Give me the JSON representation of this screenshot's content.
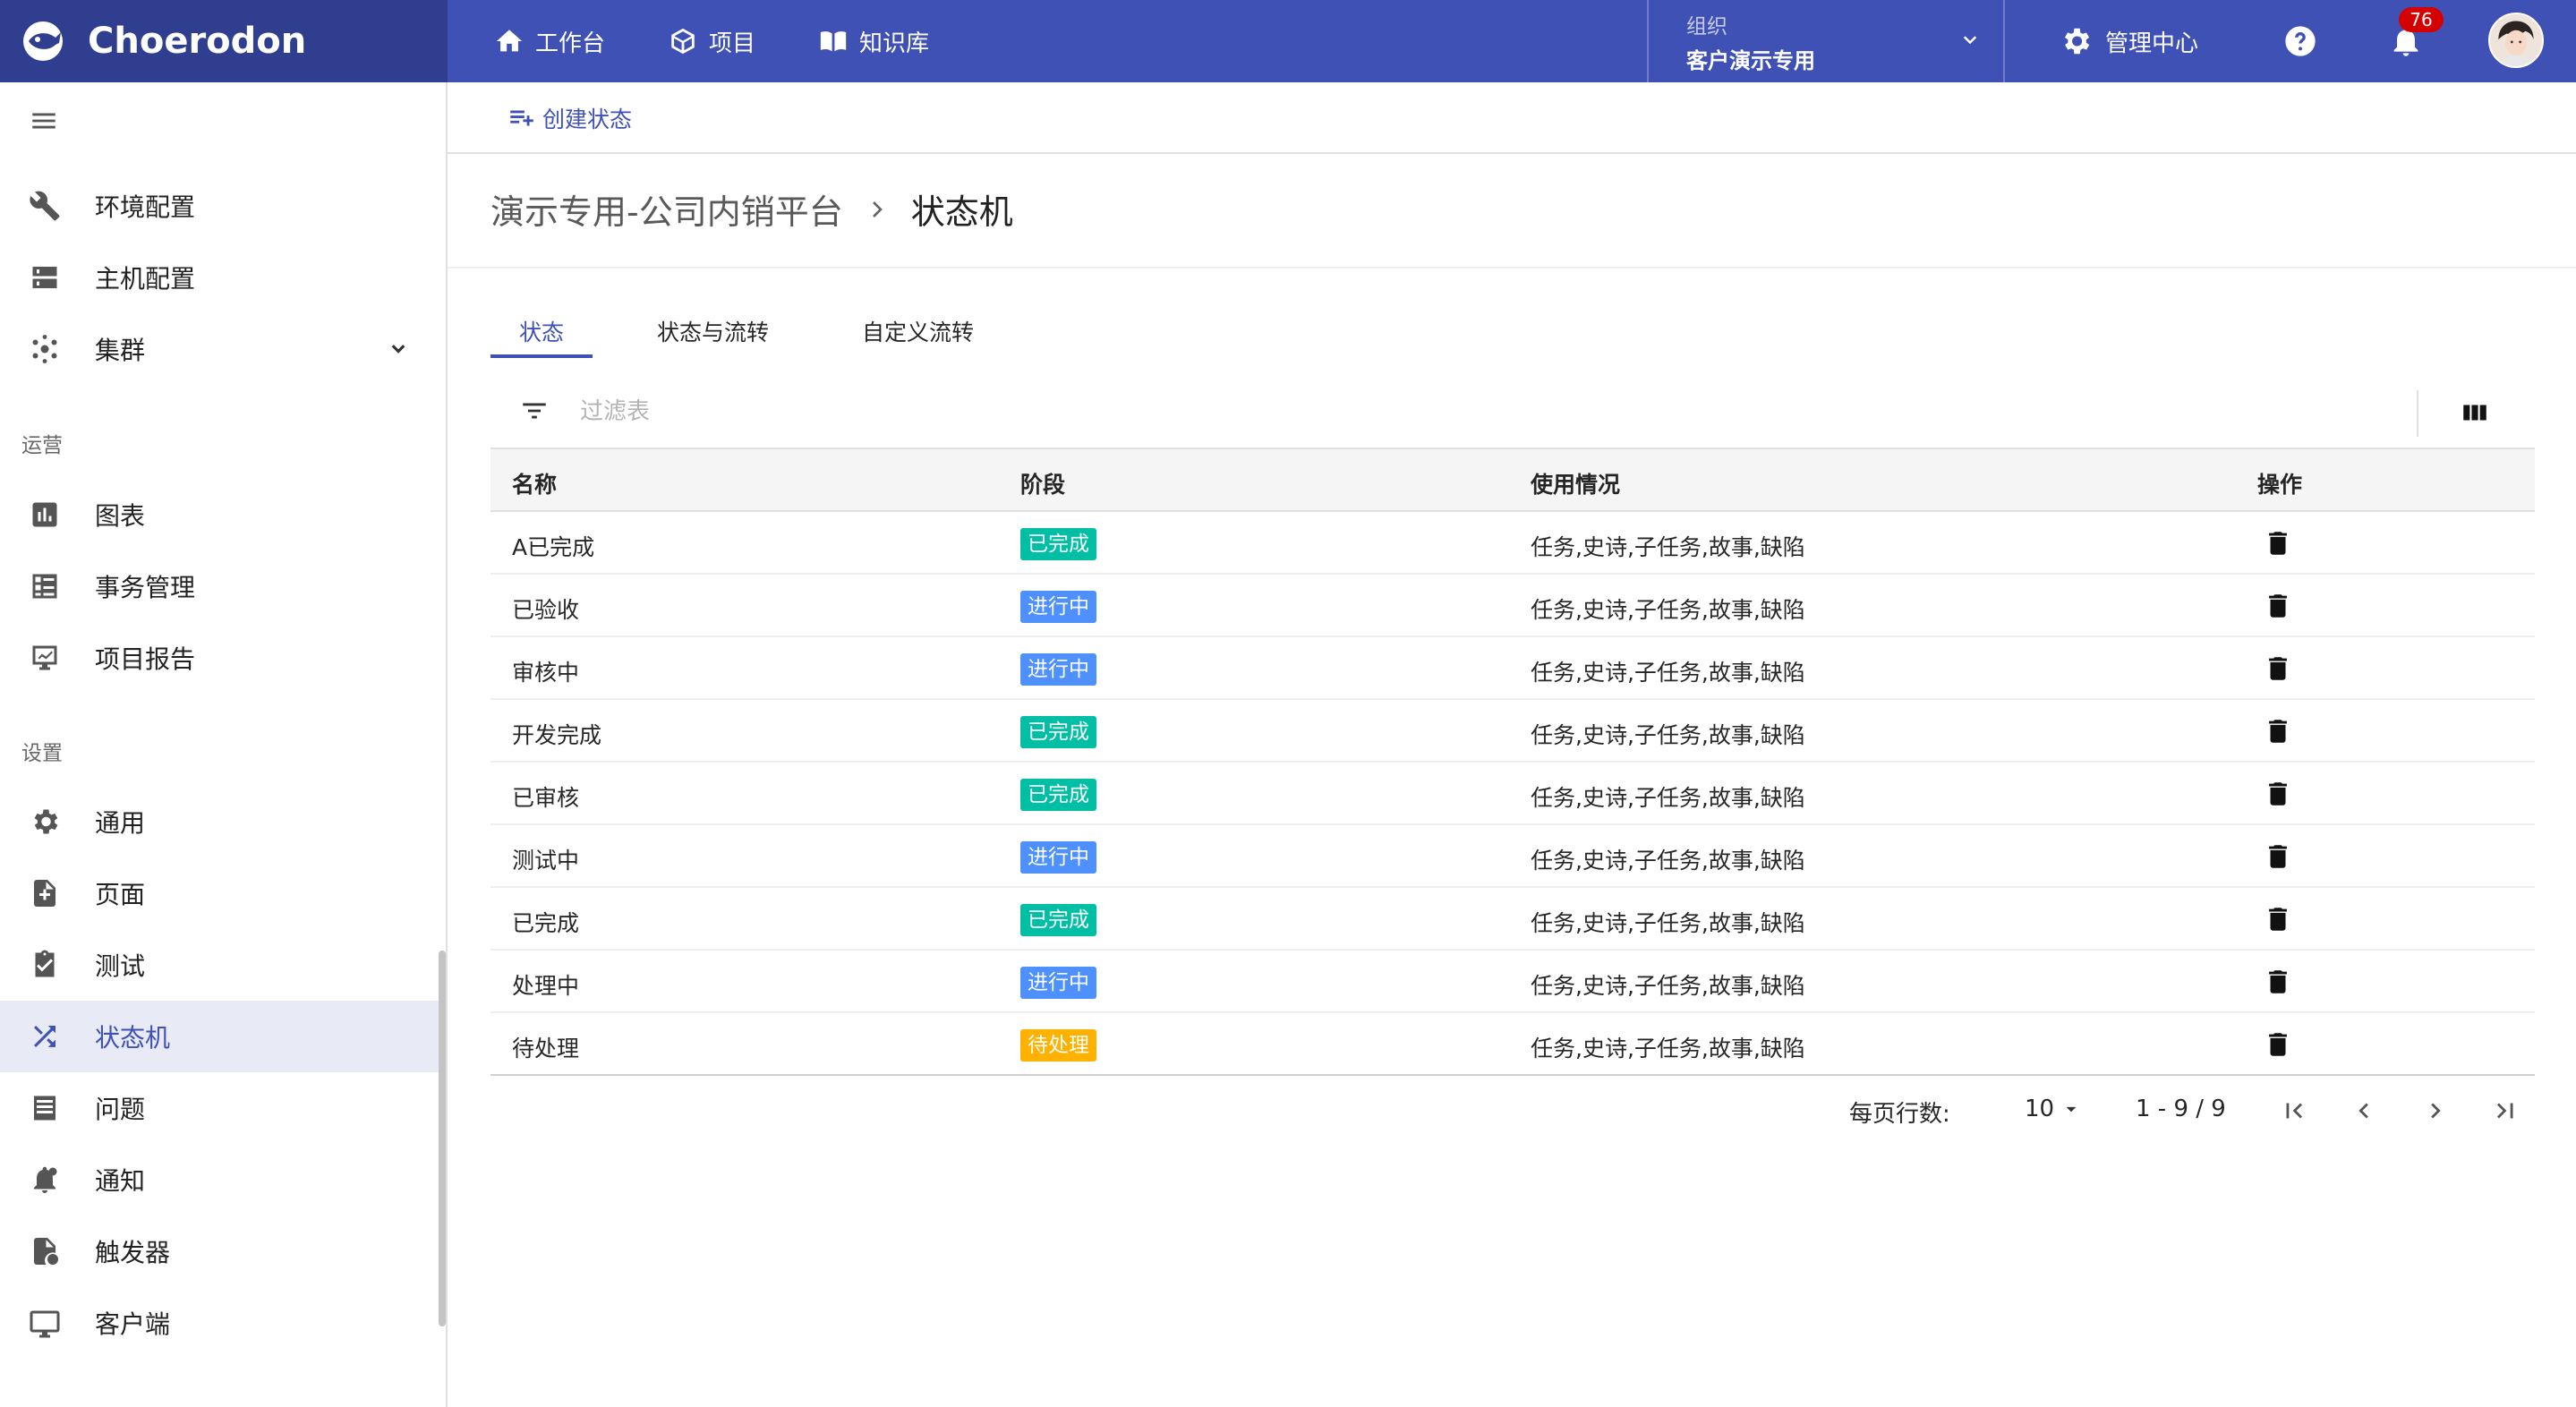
{
  "app": {
    "brand": "Choerodon"
  },
  "topnav": {
    "items": [
      {
        "label": "工作台",
        "icon": "home-icon"
      },
      {
        "label": "项目",
        "icon": "cube-icon"
      },
      {
        "label": "知识库",
        "icon": "book-icon"
      }
    ],
    "org_label": "组织",
    "org_value": "客户演示专用",
    "admin_label": "管理中心",
    "notification_count": "76"
  },
  "sidebar": {
    "items_top": [
      {
        "label": "环境配置",
        "icon": "wrench-icon"
      },
      {
        "label": "主机配置",
        "icon": "server-icon"
      },
      {
        "label": "集群",
        "icon": "cluster-icon"
      }
    ],
    "section_ops": "运营",
    "items_ops": [
      {
        "label": "图表",
        "icon": "chart-icon"
      },
      {
        "label": "事务管理",
        "icon": "task-list-icon"
      },
      {
        "label": "项目报告",
        "icon": "report-icon"
      }
    ],
    "section_settings": "设置",
    "items_settings": [
      {
        "label": "通用",
        "icon": "gear-icon"
      },
      {
        "label": "页面",
        "icon": "page-add-icon"
      },
      {
        "label": "测试",
        "icon": "clipboard-check-icon"
      },
      {
        "label": "状态机",
        "icon": "shuffle-icon",
        "active": true
      },
      {
        "label": "问题",
        "icon": "list-icon"
      },
      {
        "label": "通知",
        "icon": "bell-settings-icon"
      },
      {
        "label": "触发器",
        "icon": "file-trigger-icon"
      },
      {
        "label": "客户端",
        "icon": "monitor-icon"
      }
    ]
  },
  "toolbar": {
    "create_label": "创建状态"
  },
  "breadcrumb": {
    "parent": "演示专用-公司内销平台",
    "current": "状态机"
  },
  "tabs": [
    "状态",
    "状态与流转",
    "自定义流转"
  ],
  "filter": {
    "placeholder": "过滤表"
  },
  "table": {
    "columns": [
      "名称",
      "阶段",
      "使用情况",
      "操作"
    ],
    "rows": [
      {
        "name": "A已完成",
        "stage": "已完成",
        "usage": "任务,史诗,子任务,故事,缺陷"
      },
      {
        "name": "已验收",
        "stage": "进行中",
        "usage": "任务,史诗,子任务,故事,缺陷"
      },
      {
        "name": "审核中",
        "stage": "进行中",
        "usage": "任务,史诗,子任务,故事,缺陷"
      },
      {
        "name": "开发完成",
        "stage": "已完成",
        "usage": "任务,史诗,子任务,故事,缺陷"
      },
      {
        "name": "已审核",
        "stage": "已完成",
        "usage": "任务,史诗,子任务,故事,缺陷"
      },
      {
        "name": "测试中",
        "stage": "进行中",
        "usage": "任务,史诗,子任务,故事,缺陷"
      },
      {
        "name": "已完成",
        "stage": "已完成",
        "usage": "任务,史诗,子任务,故事,缺陷"
      },
      {
        "name": "处理中",
        "stage": "进行中",
        "usage": "任务,史诗,子任务,故事,缺陷"
      },
      {
        "name": "待处理",
        "stage": "待处理",
        "usage": "任务,史诗,子任务,故事,缺陷"
      }
    ]
  },
  "stage_colors": {
    "已完成": "#00bfa5",
    "进行中": "#4d90fe",
    "待处理": "#ffb100"
  },
  "pagination": {
    "rows_label": "每页行数:",
    "page_size": "10",
    "range": "1 - 9 / 9"
  },
  "colors": {
    "primary": "#3f51b5",
    "logo_bg": "#2f3e8f"
  }
}
